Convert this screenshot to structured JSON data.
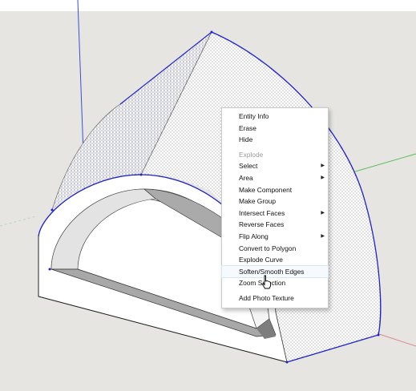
{
  "context_menu": {
    "items": [
      {
        "label": "Entity Info",
        "disabled": false,
        "submenu": false
      },
      {
        "label": "Erase",
        "disabled": false,
        "submenu": false
      },
      {
        "label": "Hide",
        "disabled": false,
        "submenu": false
      },
      {
        "separator": true
      },
      {
        "label": "Explode",
        "disabled": true,
        "submenu": false
      },
      {
        "label": "Select",
        "disabled": false,
        "submenu": true
      },
      {
        "label": "Area",
        "disabled": false,
        "submenu": true
      },
      {
        "label": "Make Component",
        "disabled": false,
        "submenu": false
      },
      {
        "label": "Make Group",
        "disabled": false,
        "submenu": false
      },
      {
        "label": "Intersect Faces",
        "disabled": false,
        "submenu": true
      },
      {
        "label": "Reverse Faces",
        "disabled": false,
        "submenu": false
      },
      {
        "label": "Flip Along",
        "disabled": false,
        "submenu": true
      },
      {
        "label": "Convert to Polygon",
        "disabled": false,
        "submenu": false
      },
      {
        "label": "Explode Curve",
        "disabled": false,
        "submenu": false
      },
      {
        "label": "Soften/Smooth Edges",
        "disabled": false,
        "submenu": false,
        "highlighted": true
      },
      {
        "label": "Zoom Selection",
        "disabled": false,
        "submenu": false
      },
      {
        "separator": true
      },
      {
        "label": "Add Photo Texture",
        "disabled": false,
        "submenu": false
      }
    ]
  },
  "colors": {
    "background": "#e6e5e2",
    "selection_edge": "#1f22c8",
    "blue_axis": "#3b4fd6",
    "green_axis": "#5bbf5b",
    "red_axis": "#d98a8a",
    "menu_highlight": "#f6fafe"
  },
  "icons": {
    "submenu_arrow": "▶",
    "cursor": "hand-pointer-icon"
  }
}
